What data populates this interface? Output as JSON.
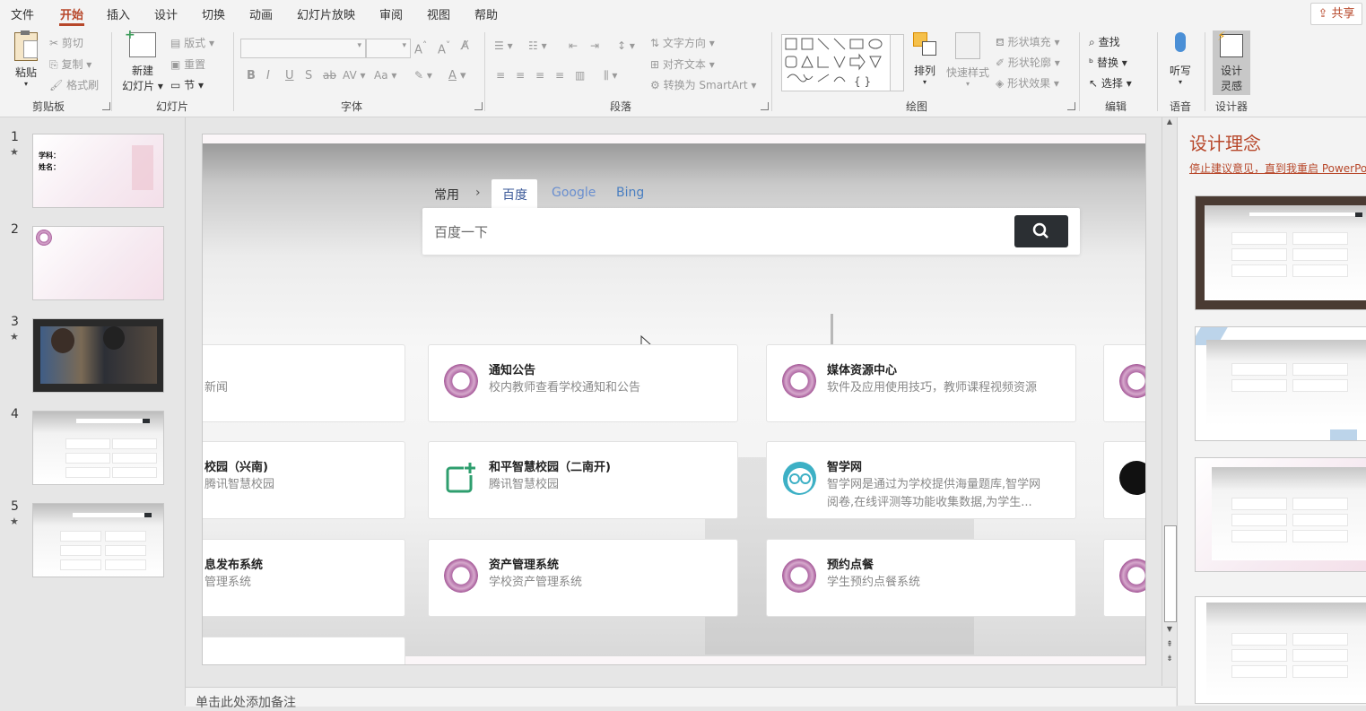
{
  "menu": {
    "items": [
      "文件",
      "开始",
      "插入",
      "设计",
      "切换",
      "动画",
      "幻灯片放映",
      "审阅",
      "视图",
      "帮助"
    ],
    "share_label": "共享"
  },
  "ribbon": {
    "clipboard": {
      "paste": "粘贴",
      "cut": "剪切",
      "copy": "复制",
      "format_painter": "格式刷",
      "group": "剪贴板"
    },
    "slides": {
      "new_slide": "新建",
      "new_slide_2": "幻灯片",
      "layout": "版式",
      "reset": "重置",
      "section": "节",
      "group": "幻灯片"
    },
    "font": {
      "group": "字体"
    },
    "paragraph": {
      "text_direction": "文字方向",
      "align_text": "对齐文本",
      "convert_smartart": "转换为 SmartArt",
      "group": "段落"
    },
    "drawing": {
      "arrange": "排列",
      "quick_styles": "快速样式",
      "shape_fill": "形状填充",
      "shape_outline": "形状轮廓",
      "shape_effects": "形状效果",
      "group": "绘图"
    },
    "editing": {
      "find": "查找",
      "replace": "替换",
      "select": "选择",
      "group": "编辑"
    },
    "voice": {
      "dictate": "听写",
      "group": "语音"
    },
    "designer": {
      "design_ideas": "设计",
      "design_ideas_2": "灵感",
      "group": "设计器"
    }
  },
  "thumbnails": [
    {
      "num": "1",
      "star": "★",
      "line1": "学科：",
      "line2": "姓名："
    },
    {
      "num": "2",
      "star": ""
    },
    {
      "num": "3",
      "star": "★"
    },
    {
      "num": "4",
      "star": ""
    },
    {
      "num": "5",
      "star": "★"
    }
  ],
  "slide": {
    "breadcrumb": "常用",
    "chevron": "›",
    "tabs": [
      "百度",
      "Google",
      "Bing"
    ],
    "search_placeholder": "百度一下",
    "cards": [
      {
        "title": "",
        "desc": "新闻"
      },
      {
        "title": "通知公告",
        "desc": "校内教师查看学校通知和公告"
      },
      {
        "title": "媒体资源中心",
        "desc": "软件及应用使用技巧，教师课程视频资源"
      },
      {
        "title": "校园（兴南)",
        "desc": "腾讯智慧校园"
      },
      {
        "title": "和平智慧校园（二南开)",
        "desc": "腾讯智慧校园"
      },
      {
        "title": "智学网",
        "desc": "智学网是通过为学校提供海量题库,智学网",
        "desc2": "阅卷,在线评测等功能收集数据,为学生..."
      },
      {
        "title": "息发布系统",
        "desc": "管理系统"
      },
      {
        "title": "资产管理系统",
        "desc": "学校资产管理系统"
      },
      {
        "title": "预约点餐",
        "desc": "学生预约点餐系统"
      }
    ]
  },
  "design_pane": {
    "title": "设计理念",
    "link": "停止建议意见，直到我重启 PowerPo"
  },
  "notes": {
    "placeholder": "单击此处添加备注"
  },
  "colors": {
    "accent": "#b7472a",
    "search_button": "#2b2f33"
  }
}
